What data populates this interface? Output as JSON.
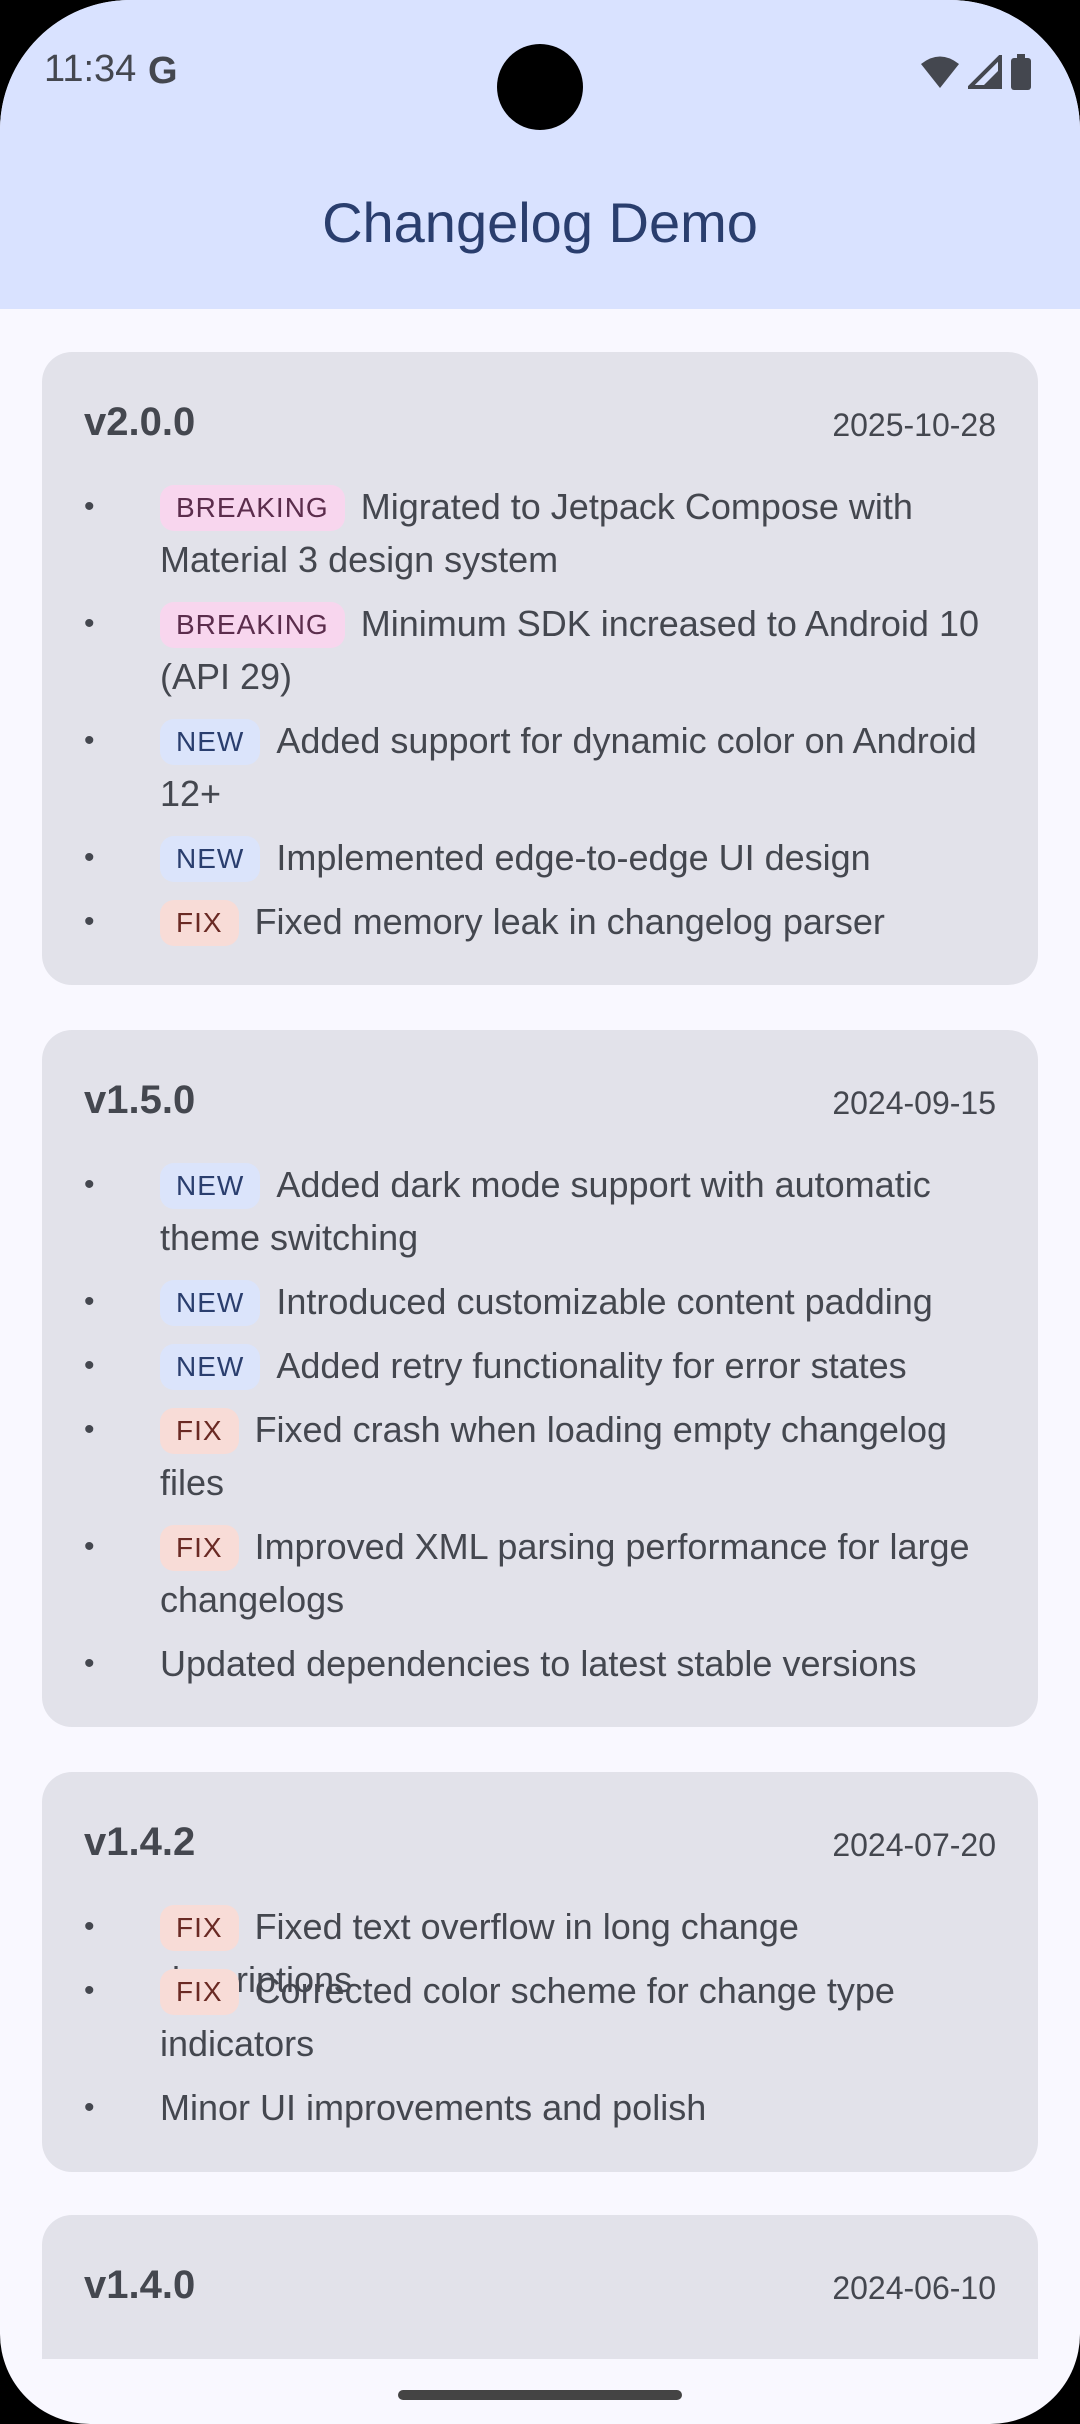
{
  "status_bar": {
    "time": "11:34",
    "g_icon": "G"
  },
  "app_bar": {
    "title": "Changelog Demo"
  },
  "releases": [
    {
      "version": "v2.0.0",
      "date": "2025-10-28",
      "items": [
        {
          "tag": "BREAKING",
          "text": "Migrated to Jetpack Compose with Material 3 design system"
        },
        {
          "tag": "BREAKING",
          "text": "Minimum SDK increased to Android 10 (API 29)"
        },
        {
          "tag": "NEW",
          "text": "Added support for dynamic color on Android 12+"
        },
        {
          "tag": "NEW",
          "text": "Implemented edge-to-edge UI design"
        },
        {
          "tag": "FIX",
          "text": "Fixed memory leak in changelog parser"
        }
      ]
    },
    {
      "version": "v1.5.0",
      "date": "2024-09-15",
      "items": [
        {
          "tag": "NEW",
          "text": "Added dark mode support with automatic theme switching"
        },
        {
          "tag": "NEW",
          "text": "Introduced customizable content padding"
        },
        {
          "tag": "NEW",
          "text": "Added retry functionality for error states"
        },
        {
          "tag": "FIX",
          "text": "Fixed crash when loading empty changelog files"
        },
        {
          "tag": "FIX",
          "text": "Improved XML parsing performance for large changelogs"
        },
        {
          "tag": "",
          "text": "Updated dependencies to latest stable versions"
        }
      ]
    },
    {
      "version": "v1.4.2",
      "date": "2024-07-20",
      "items": [
        {
          "tag": "FIX",
          "text": "Fixed text overflow in long change descriptions"
        },
        {
          "tag": "FIX",
          "text": "Corrected color scheme for change type indicators"
        },
        {
          "tag": "",
          "text": "Minor UI improvements and polish"
        }
      ]
    },
    {
      "version": "v1.4.0",
      "date": "2024-06-10",
      "items": []
    }
  ],
  "colors": {
    "app_bar_bg": "#d9e2ff",
    "card_bg": "#e2e2ea",
    "breaking_bg": "#f8d6ee",
    "new_bg": "#dbe4fb",
    "fix_bg": "#f8dcd7"
  }
}
